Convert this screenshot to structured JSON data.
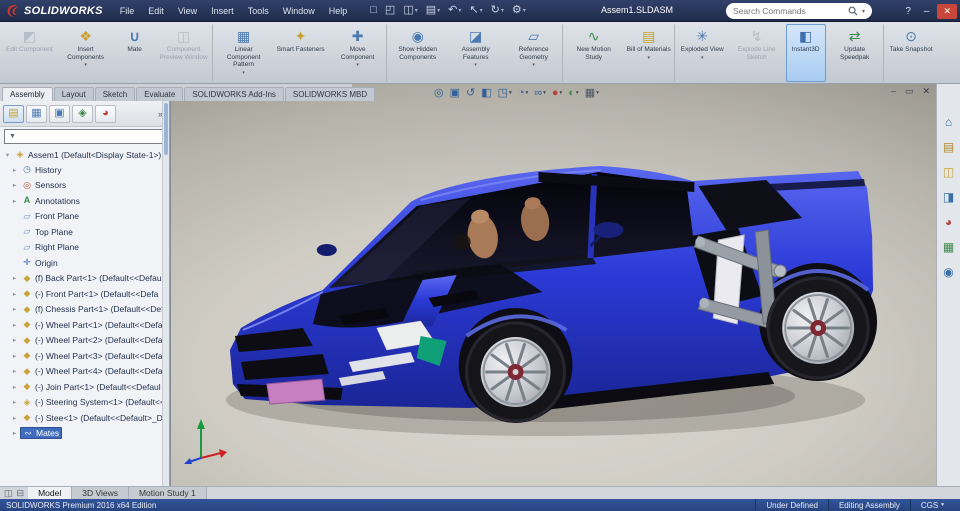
{
  "ui": {
    "dropdown_glyph": "▾",
    "expander_glyph": "▸",
    "root_expander_glyph": "▾",
    "overflow_glyph": "»",
    "funnel_glyph": "▼"
  },
  "titlebar": {
    "brand": "SOLIDWORKS",
    "menus": [
      {
        "label": "File"
      },
      {
        "label": "Edit"
      },
      {
        "label": "View"
      },
      {
        "label": "Insert"
      },
      {
        "label": "Tools"
      },
      {
        "label": "Window"
      },
      {
        "label": "Help"
      }
    ],
    "quick_tools": [
      {
        "icon": "new-file"
      },
      {
        "icon": "open-file"
      },
      {
        "icon": "save",
        "dropdown": true
      },
      {
        "icon": "print",
        "dropdown": true
      },
      {
        "icon": "undo",
        "dropdown": true
      },
      {
        "icon": "select-arrow",
        "dropdown": true
      },
      {
        "icon": "rebuild",
        "dropdown": true
      },
      {
        "icon": "options-gear",
        "dropdown": true
      }
    ],
    "document_title": "Assem1.SLDASM",
    "search": {
      "placeholder": "Search Commands"
    },
    "help_label": "?",
    "minimize_label": "–",
    "close_label": "✕"
  },
  "ribbon": {
    "buttons": [
      {
        "label": "Edit Component",
        "icon": "edit-component",
        "disabled": true
      },
      {
        "label": "Insert Components",
        "icon": "insert-components",
        "dropdown": true
      },
      {
        "label": "Mate",
        "icon": "mate"
      },
      {
        "label": "Component Preview Window",
        "icon": "component-preview-window",
        "disabled": true
      },
      {
        "label": "Linear Component Pattern",
        "icon": "linear-component-pattern",
        "dropdown": true
      },
      {
        "label": "Smart Fasteners",
        "icon": "smart-fasteners"
      },
      {
        "label": "Move Component",
        "icon": "move-component",
        "dropdown": true
      },
      {
        "label": "Show Hidden Components",
        "icon": "show-hidden-components"
      },
      {
        "label": "Assembly Features",
        "icon": "assembly-features",
        "dropdown": true
      },
      {
        "label": "Reference Geometry",
        "icon": "reference-geometry",
        "dropdown": true
      },
      {
        "label": "New Motion Study",
        "icon": "new-motion-study"
      },
      {
        "label": "Bill of Materials",
        "icon": "bill-of-materials",
        "dropdown": true
      },
      {
        "label": "Exploded View",
        "icon": "exploded-view",
        "dropdown": true
      },
      {
        "label": "Explode Line Sketch",
        "icon": "explode-line-sketch",
        "disabled": true
      },
      {
        "label": "Instant3D",
        "icon": "instant3d",
        "active": true
      },
      {
        "label": "Update Speedpak",
        "icon": "update-speedpak"
      },
      {
        "label": "Take Snapshot",
        "icon": "take-snapshot"
      }
    ]
  },
  "command_tabs": {
    "items": [
      {
        "label": "Assembly",
        "active": true
      },
      {
        "label": "Layout"
      },
      {
        "label": "Sketch"
      },
      {
        "label": "Evaluate"
      },
      {
        "label": "SOLIDWORKS Add-Ins"
      },
      {
        "label": "SOLIDWORKS MBD"
      }
    ]
  },
  "headsup_toolbar": {
    "items": [
      {
        "icon": "zoom-to-fit"
      },
      {
        "icon": "zoom-to-area"
      },
      {
        "icon": "previous-view"
      },
      {
        "icon": "section-view"
      },
      {
        "icon": "view-orientation",
        "dropdown": true
      },
      {
        "icon": "display-style",
        "dropdown": true
      },
      {
        "icon": "hide-show-items",
        "dropdown": true
      },
      {
        "icon": "edit-appearance",
        "dropdown": true
      },
      {
        "icon": "apply-scene",
        "dropdown": true
      },
      {
        "icon": "view-settings",
        "dropdown": true
      }
    ]
  },
  "doc_window": {
    "minimize": "–",
    "restore": "▭",
    "close": "✕"
  },
  "feature_panel": {
    "tabs": [
      {
        "icon": "feature-tree"
      },
      {
        "icon": "property-manager"
      },
      {
        "icon": "configuration-manager"
      },
      {
        "icon": "dimxpert-manager"
      },
      {
        "icon": "display-manager"
      }
    ],
    "filter": {
      "value": "",
      "placeholder": ""
    },
    "root": {
      "label": "Assem1 (Default<Display State-1>)",
      "icon": "assembly"
    },
    "items": [
      {
        "icon": "history-folder",
        "label": "History"
      },
      {
        "icon": "sensors",
        "label": "Sensors"
      },
      {
        "icon": "annotations-folder",
        "label": "Annotations"
      },
      {
        "icon": "plane",
        "label": "Front Plane",
        "noexpand": true
      },
      {
        "icon": "plane",
        "label": "Top Plane",
        "noexpand": true
      },
      {
        "icon": "plane",
        "label": "Right Plane",
        "noexpand": true
      },
      {
        "icon": "origin",
        "label": "Origin",
        "noexpand": true
      },
      {
        "icon": "part",
        "label": "(f) Back Part<1> (Default<<Defaul"
      },
      {
        "icon": "part",
        "label": "(-) Front Part<1> (Default<<Defa"
      },
      {
        "icon": "part",
        "label": "(f) Chessis Part<1> (Default<<Def"
      },
      {
        "icon": "part",
        "label": "(-) Wheel Part<1> (Default<<Defa"
      },
      {
        "icon": "part",
        "label": "(-) Wheel Part<2> (Default<<Defa"
      },
      {
        "icon": "part",
        "label": "(-) Wheel Part<3> (Default<<Defa"
      },
      {
        "icon": "part",
        "label": "(-) Wheel Part<4> (Default<<Defa"
      },
      {
        "icon": "part",
        "label": "(-) Join Part<1> (Default<<Defaul"
      },
      {
        "icon": "assembly",
        "label": "(-) Steering System<1> (Default<<"
      },
      {
        "icon": "part",
        "label": "(-) Stee<1> (Default<<Default>_D"
      },
      {
        "icon": "mates-folder",
        "label": "Mates",
        "selected": true
      }
    ]
  },
  "viewport": {
    "model_colors": {
      "body_blue": "#2e3bd8",
      "glass_black": "#0a0a14",
      "accent_green": "#0fa078",
      "license_plate_pink": "#c77fc2",
      "interior_tan": "#a87a58",
      "rim_silver": "#c9cbd1"
    }
  },
  "task_pane": {
    "items": [
      {
        "icon": "home"
      },
      {
        "icon": "design-library"
      },
      {
        "icon": "file-explorer"
      },
      {
        "icon": "view-palette"
      },
      {
        "icon": "appearances-scenes"
      },
      {
        "icon": "custom-properties"
      },
      {
        "icon": "solidworks-forum"
      }
    ]
  },
  "bottom_tabs": {
    "splitters": [
      {
        "icon": "split-horizontal"
      },
      {
        "icon": "split-vertical"
      }
    ],
    "items": [
      {
        "label": "Model",
        "active": true
      },
      {
        "label": "3D Views"
      },
      {
        "label": "Motion Study 1"
      }
    ]
  },
  "status_bar": {
    "left": "SOLIDWORKS Premium 2016 x64 Edition",
    "items": [
      {
        "label": "Under Defined"
      },
      {
        "label": "Editing Assembly"
      },
      {
        "label": "CGS",
        "dropdown": true
      }
    ]
  }
}
